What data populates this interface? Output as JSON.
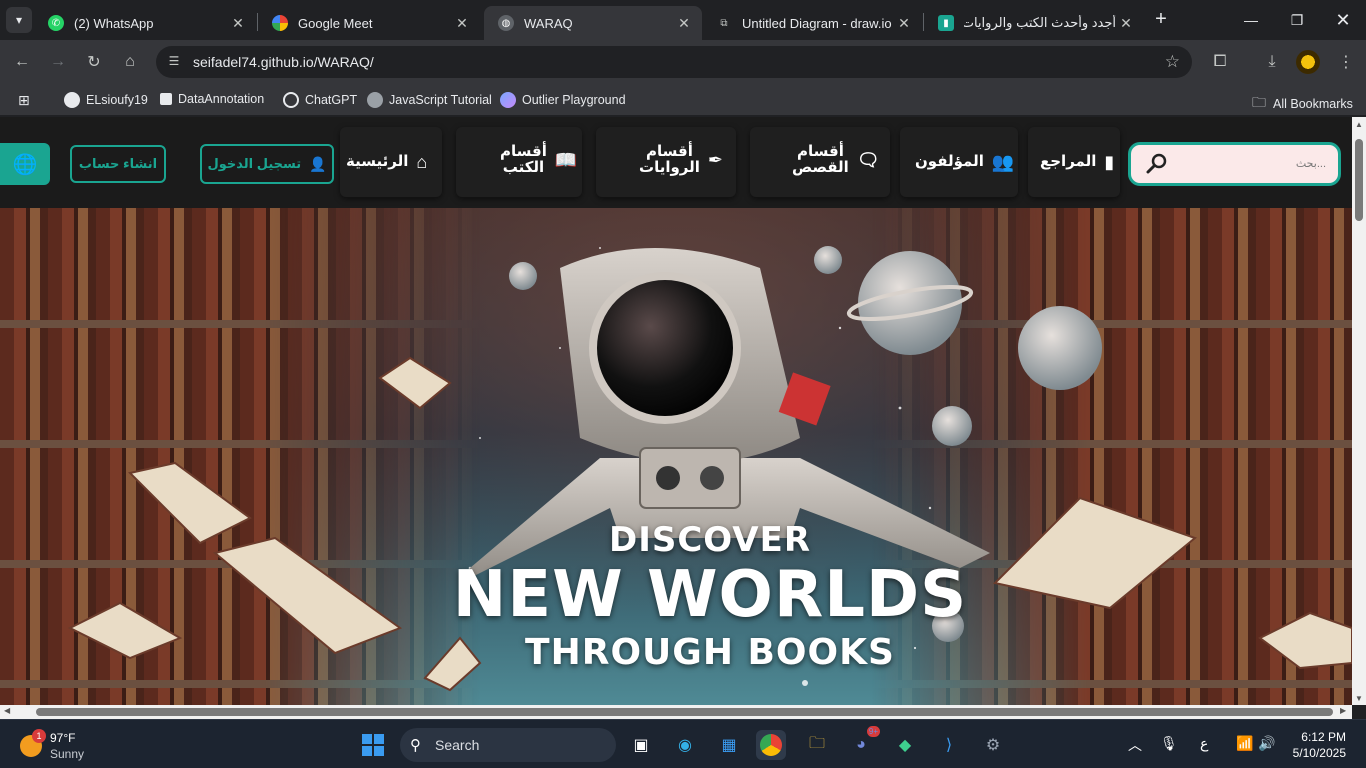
{
  "browser": {
    "tabs": [
      {
        "title": "(2) WhatsApp",
        "icon": "whatsapp-icon"
      },
      {
        "title": "Google Meet",
        "icon": "google-meet-icon"
      },
      {
        "title": "WARAQ",
        "icon": "globe-icon",
        "active": true
      },
      {
        "title": "Untitled Diagram - draw.io",
        "icon": "drawio-icon"
      },
      {
        "title": "أجدد وأحدث الكتب والروايات ال",
        "icon": "book-site-icon"
      }
    ],
    "url": "seifadel74.github.io/WARAQ/",
    "bookmarks": [
      "ELsioufy19",
      "DataAnnotation",
      "ChatGPT",
      "JavaScript Tutorial",
      "Outlier Playground"
    ],
    "all_bookmarks": "All Bookmarks"
  },
  "site": {
    "search_placeholder": "بحث...",
    "nav": {
      "references": "المراجع",
      "authors": "المؤلفون",
      "stories_line1": "أقسام",
      "stories_line2": "القصص",
      "novels_line1": "أقسام",
      "novels_line2": "الروايات",
      "books_line1": "أقسام",
      "books_line2": "الكتب",
      "home": "الرئيسية"
    },
    "login": "تسجيل الدخول",
    "signup": "انشاء حساب",
    "accent": "#1aa591",
    "hero": {
      "line1": "DISCOVER",
      "line2": "NEW WORLDS",
      "line3": "THROUGH BOOKS"
    }
  },
  "taskbar": {
    "weather_temp": "97°F",
    "weather_cond": "Sunny",
    "weather_badge": "1",
    "search_label": "Search",
    "lang": "ع",
    "time": "6:12 PM",
    "date": "5/10/2025",
    "discord_badge": "9+"
  }
}
